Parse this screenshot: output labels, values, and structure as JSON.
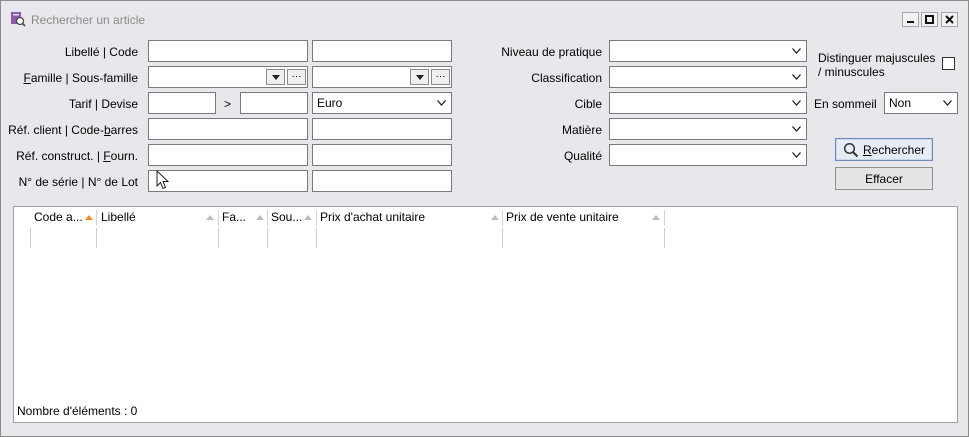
{
  "window": {
    "title": "Rechercher un article"
  },
  "form": {
    "libelle_code_label": "Libellé | Code",
    "famille_label_pre": "",
    "famille_label_u": "F",
    "famille_label_post": "amille | Sous-famille",
    "tarif_label": "Tarif | Devise",
    "tarif_sep": ">",
    "devise_value": "Euro",
    "ref_client_label_pre": "Réf. client | Code-",
    "ref_client_label_u": "b",
    "ref_client_label_post": "arres",
    "ref_construct_label_pre": "Réf. construct. | ",
    "ref_construct_label_u": "F",
    "ref_construct_label_post": "ourn.",
    "serie_label": "N° de série | N° de Lot",
    "niveau_label": "Niveau de pratique",
    "classification_label": "Classification",
    "cible_label": "Cible",
    "matiere_label": "Matière",
    "qualite_label": "Qualité",
    "distinguer_label_line1": "Distinguer majuscules",
    "distinguer_label_line2": "/ minuscules",
    "sommeil_label": "En sommeil",
    "sommeil_value": "Non",
    "ellipsis": "···"
  },
  "buttons": {
    "rechercher_u": "R",
    "rechercher_rest": "echercher",
    "effacer": "Effacer"
  },
  "grid": {
    "columns": [
      {
        "label": "Code a..."
      },
      {
        "label": "Libellé"
      },
      {
        "label": "Fa..."
      },
      {
        "label": "Sou..."
      },
      {
        "label": "Prix d'achat unitaire"
      },
      {
        "label": "Prix de vente unitaire"
      }
    ],
    "status": "Nombre d'éléments : 0"
  }
}
